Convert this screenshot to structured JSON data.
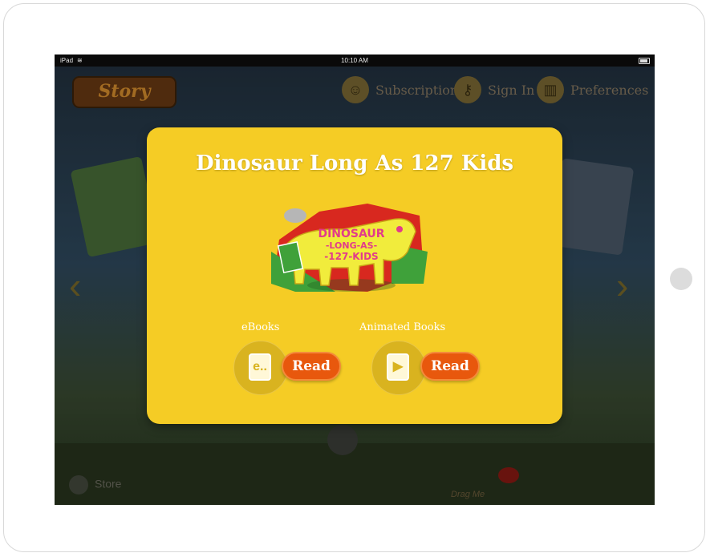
{
  "statusbar": {
    "carrier": "iPad",
    "time": "10:10 AM"
  },
  "app": {
    "logo": "Story",
    "nav": [
      {
        "label": "Subscription",
        "icon": "person-icon"
      },
      {
        "label": "Sign In",
        "icon": "key-icon"
      },
      {
        "label": "Preferences",
        "icon": "gift-icon"
      }
    ],
    "store_label": "Store",
    "drag_label": "Drag Me"
  },
  "modal": {
    "title": "Dinosaur Long As 127 Kids",
    "cover_text": [
      "DINOSAUR",
      "-LONG-AS-",
      "-127-KIDS"
    ],
    "ebooks": {
      "label": "eBooks",
      "icon_glyph": "e..",
      "button": "Read"
    },
    "animated": {
      "label": "Animated Books",
      "icon_glyph": "▶",
      "button": "Read"
    }
  },
  "colors": {
    "modal_bg": "#f5cc25",
    "read_button": "#e8580d",
    "title_text": "#ffffff"
  }
}
